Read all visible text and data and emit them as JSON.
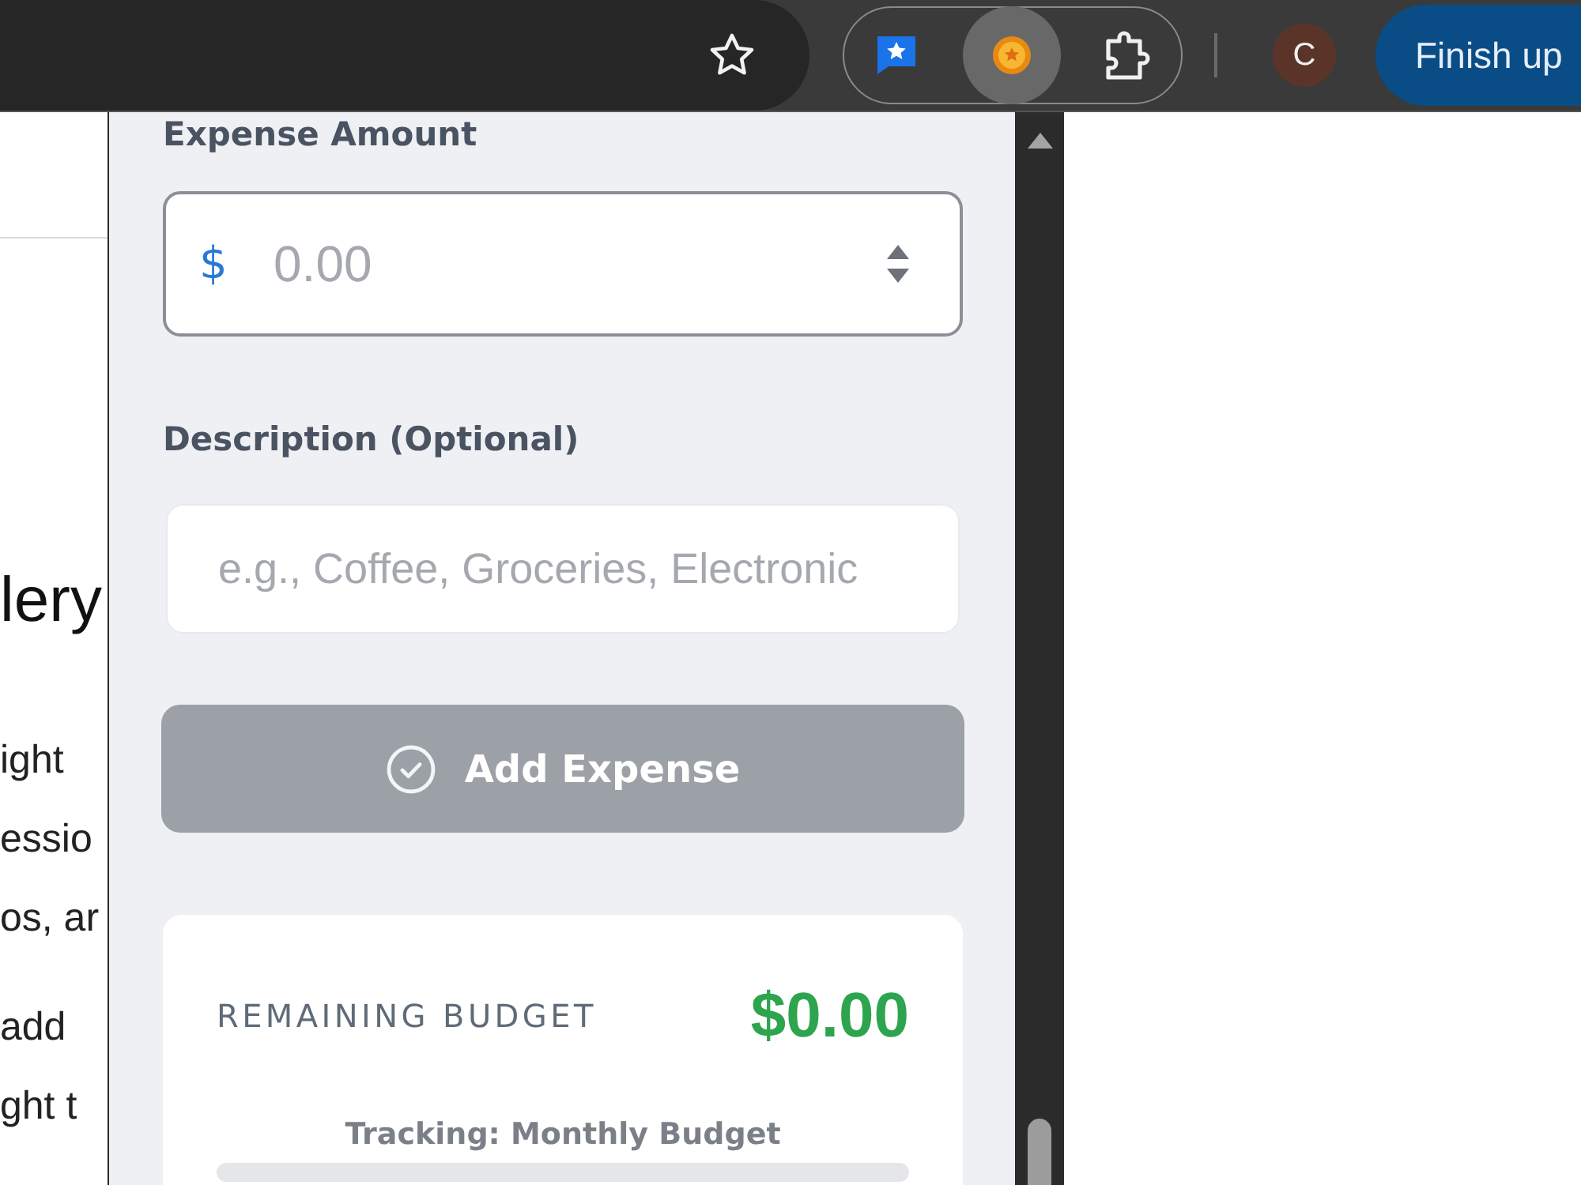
{
  "browser": {
    "extensions": [
      {
        "kind": "bubble",
        "selected": false
      },
      {
        "kind": "coin",
        "selected": true
      },
      {
        "kind": "puzzle",
        "selected": false
      }
    ],
    "profile": {
      "initial": "C"
    },
    "update_button": {
      "label": "Finish up"
    }
  },
  "page": {
    "heading": "lery",
    "paragraphs": [
      [
        "ight",
        "essio",
        "os, ar"
      ],
      [
        "add",
        "ght t"
      ]
    ]
  },
  "popup": {
    "amount": {
      "label": "Expense Amount",
      "currency": "$",
      "placeholder": "0.00"
    },
    "description": {
      "label": "Description (Optional)",
      "placeholder": "e.g., Coffee, Groceries, Electronic"
    },
    "add_button": {
      "label": "Add Expense",
      "disabled": true
    },
    "budget": {
      "label": "REMAINING BUDGET",
      "amount": "$0.00",
      "tracking": "Tracking: Monthly Budget",
      "level": 0
    }
  }
}
